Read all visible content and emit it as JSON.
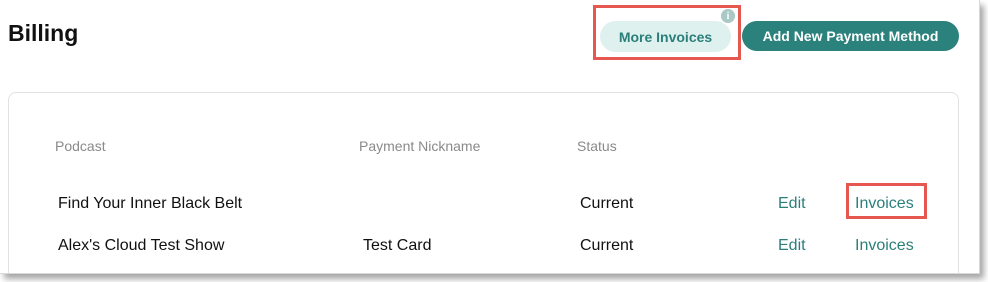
{
  "page": {
    "title": "Billing"
  },
  "header": {
    "more_invoices_label": "More Invoices",
    "info_icon": "i",
    "add_payment_label": "Add New Payment Method"
  },
  "table": {
    "columns": [
      "Podcast",
      "Payment Nickname",
      "Status"
    ],
    "rows": [
      {
        "podcast": "Find Your Inner Black Belt",
        "nickname": "",
        "status": "Current",
        "edit": "Edit",
        "invoices": "Invoices"
      },
      {
        "podcast": "Alex's Cloud Test Show",
        "nickname": "Test Card",
        "status": "Current",
        "edit": "Edit",
        "invoices": "Invoices"
      }
    ]
  },
  "colors": {
    "accent": "#2b817b",
    "accent_light": "#dff1ef",
    "highlight": "#e5574f"
  }
}
